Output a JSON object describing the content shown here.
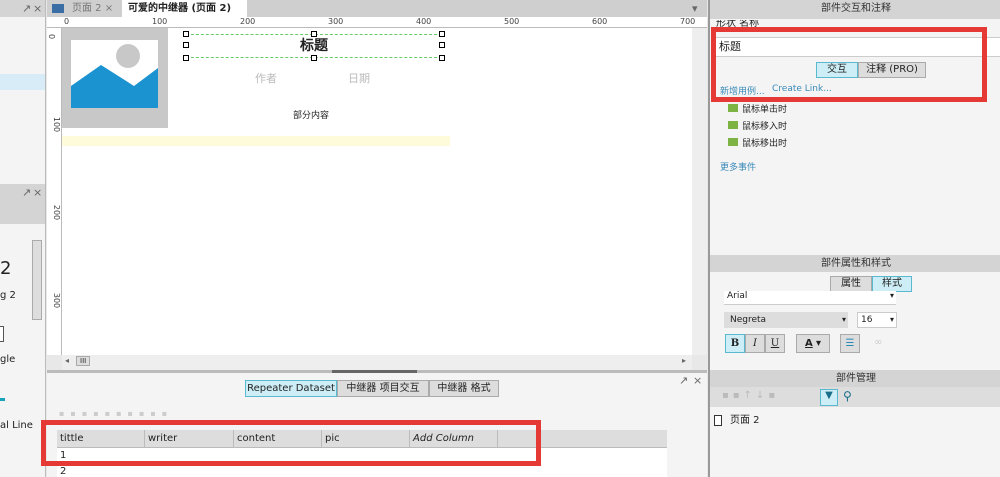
{
  "tabs": [
    {
      "label": "页面 2"
    },
    {
      "label": "可爱的中继器 (页面 2)"
    }
  ],
  "ruler": {
    "h": [
      "0",
      "100",
      "200",
      "300",
      "400",
      "500",
      "600",
      "700"
    ],
    "v": [
      "0",
      "100",
      "200",
      "300"
    ]
  },
  "canvas": {
    "title": "标题",
    "author": "作者",
    "date": "日期",
    "content": "部分内容"
  },
  "left": {
    "big": "2",
    "l1": "g 2",
    "l2": "gle",
    "l3": "al Line"
  },
  "interactions": {
    "header": "部件交互和注释",
    "name_label": "形状 名称",
    "name_value": "标题",
    "tab_interact": "交互",
    "tab_notes": "注释 (PRO)",
    "add_case": "新增用例...",
    "create_link": "Create Link...",
    "events": [
      "鼠标单击时",
      "鼠标移入时",
      "鼠标移出时"
    ],
    "more": "更多事件"
  },
  "style": {
    "header": "部件属性和样式",
    "tab_props": "属性",
    "tab_style": "样式",
    "font": "Arial",
    "weight": "Negreta",
    "size": "16",
    "bold": "B",
    "italic": "I",
    "underline": "U",
    "color": "A"
  },
  "outline": {
    "header": "部件管理",
    "page": "页面 2"
  },
  "dataset": {
    "tabs": [
      "Repeater Dataset",
      "中继器 项目交互",
      "中继器 格式"
    ],
    "columns": [
      "tittle",
      "writer",
      "content",
      "pic",
      "Add Column"
    ],
    "rows": [
      "1",
      "2"
    ]
  },
  "scroll": "III"
}
